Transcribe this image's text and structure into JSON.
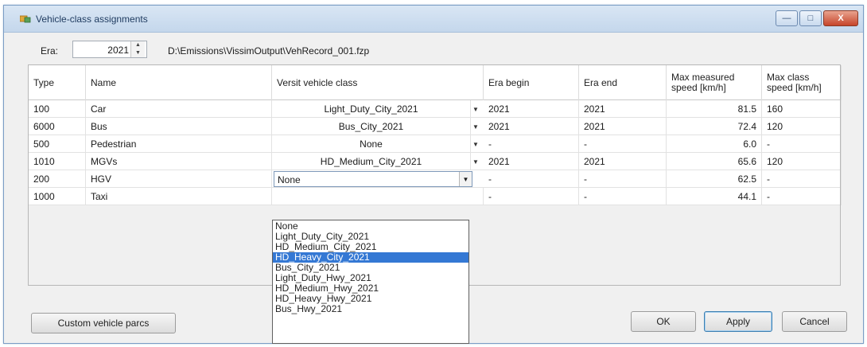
{
  "window": {
    "title": "Vehicle-class assignments",
    "controls": [
      "—",
      "□",
      "X"
    ]
  },
  "era": {
    "label": "Era:",
    "value": "2021",
    "file_path": "D:\\Emissions\\VissimOutput\\VehRecord_001.fzp"
  },
  "table": {
    "columns": [
      "Type",
      "Name",
      "Versit vehicle class",
      "Era begin",
      "Era end",
      "Max measured speed [km/h]",
      "Max class speed [km/h]"
    ],
    "rows": [
      {
        "type": "100",
        "name": "Car",
        "vclass": "Light_Duty_City_2021",
        "era_begin": "2021",
        "era_end": "2021",
        "max_measured": "81.5",
        "max_class": "160"
      },
      {
        "type": "6000",
        "name": "Bus",
        "vclass": "Bus_City_2021",
        "era_begin": "2021",
        "era_end": "2021",
        "max_measured": "72.4",
        "max_class": "120"
      },
      {
        "type": "500",
        "name": "Pedestrian",
        "vclass": "None",
        "era_begin": "-",
        "era_end": "-",
        "max_measured": "6.0",
        "max_class": "-"
      },
      {
        "type": "1010",
        "name": "MGVs",
        "vclass": "HD_Medium_City_2021",
        "era_begin": "2021",
        "era_end": "2021",
        "max_measured": "65.6",
        "max_class": "120"
      },
      {
        "type": "200",
        "name": "HGV",
        "vclass": "None",
        "era_begin": "-",
        "era_end": "-",
        "max_measured": "62.5",
        "max_class": "-"
      },
      {
        "type": "1000",
        "name": "Taxi",
        "vclass": "",
        "era_begin": "-",
        "era_end": "-",
        "max_measured": "44.1",
        "max_class": "-"
      }
    ]
  },
  "dropdown": {
    "options": [
      "None",
      "Light_Duty_City_2021",
      "HD_Medium_City_2021",
      "HD_Heavy_City_2021",
      "Bus_City_2021",
      "Light_Duty_Hwy_2021",
      "HD_Medium_Hwy_2021",
      "HD_Heavy_Hwy_2021",
      "Bus_Hwy_2021"
    ],
    "highlighted": "HD_Heavy_City_2021"
  },
  "buttons": {
    "custom": "Custom vehicle parcs",
    "ok": "OK",
    "apply": "Apply",
    "cancel": "Cancel"
  },
  "colors": {
    "selection": "#3478d4",
    "title_bar": "#c4d7ec"
  }
}
